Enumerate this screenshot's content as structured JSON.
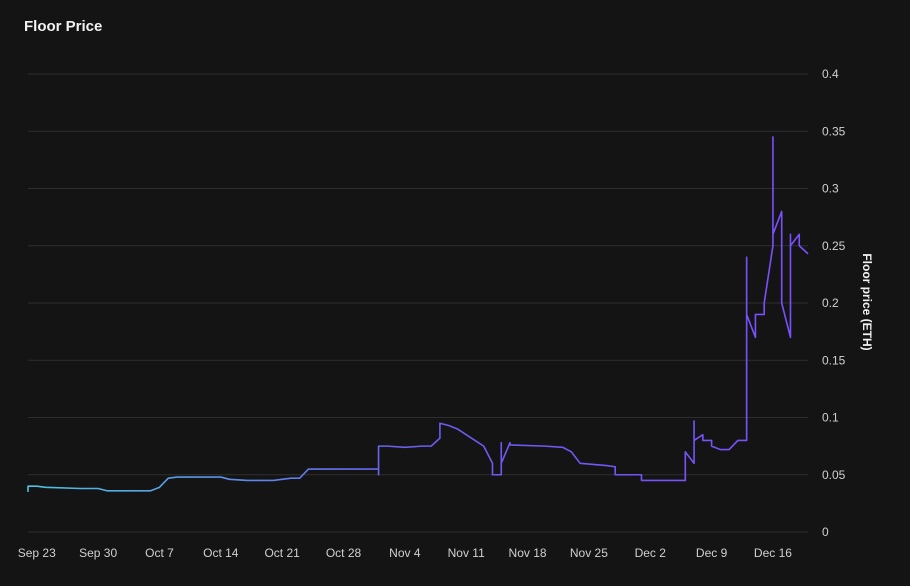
{
  "chart_data": {
    "type": "line",
    "title": "Floor Price",
    "xlabel": "",
    "ylabel": "Floor price (ETH)",
    "x_ticks": [
      "Sep 23",
      "Sep 30",
      "Oct 7",
      "Oct 14",
      "Oct 21",
      "Oct 28",
      "Nov 4",
      "Nov 11",
      "Nov 18",
      "Nov 25",
      "Dec 2",
      "Dec 9",
      "Dec 16"
    ],
    "y_ticks": [
      0,
      0.05,
      0.1,
      0.15,
      0.2,
      0.25,
      0.3,
      0.35,
      0.4
    ],
    "y_tick_labels": [
      "0",
      "0.05",
      "0.1",
      "0.15",
      "0.2",
      "0.25",
      "0.3",
      "0.35",
      "0.4"
    ],
    "ylim": [
      0,
      0.4
    ],
    "xlim": [
      "2023-09-22",
      "2023-12-20"
    ],
    "grid": true,
    "legend": "none",
    "y_axis_position": "right",
    "line_gradient": [
      "#4fc3e0",
      "#6a5cf0",
      "#7b4fff"
    ],
    "series": [
      {
        "x": [
          "2023-09-22",
          "2023-09-22",
          "2023-09-23",
          "2023-09-24",
          "2023-09-28",
          "2023-09-30",
          "2023-10-01",
          "2023-10-06",
          "2023-10-07",
          "2023-10-08",
          "2023-10-09",
          "2023-10-14",
          "2023-10-15",
          "2023-10-17",
          "2023-10-20",
          "2023-10-22",
          "2023-10-23",
          "2023-10-24",
          "2023-10-24",
          "2023-11-01",
          "2023-11-01",
          "2023-11-01",
          "2023-11-02",
          "2023-11-04",
          "2023-11-06",
          "2023-11-07",
          "2023-11-08",
          "2023-11-08",
          "2023-11-09",
          "2023-11-10",
          "2023-11-11",
          "2023-11-12",
          "2023-11-13",
          "2023-11-14",
          "2023-11-14",
          "2023-11-15",
          "2023-11-15",
          "2023-11-15",
          "2023-11-16",
          "2023-11-16",
          "2023-11-16",
          "2023-11-20",
          "2023-11-22",
          "2023-11-23",
          "2023-11-24",
          "2023-11-27",
          "2023-11-28",
          "2023-11-28",
          "2023-12-01",
          "2023-12-01",
          "2023-12-06",
          "2023-12-06",
          "2023-12-07",
          "2023-12-07",
          "2023-12-07",
          "2023-12-08",
          "2023-12-08",
          "2023-12-09",
          "2023-12-09",
          "2023-12-10",
          "2023-12-11",
          "2023-12-12",
          "2023-12-13",
          "2023-12-13",
          "2023-12-13",
          "2023-12-14",
          "2023-12-14",
          "2023-12-14",
          "2023-12-15",
          "2023-12-15",
          "2023-12-16",
          "2023-12-16",
          "2023-12-16",
          "2023-12-16",
          "2023-12-17",
          "2023-12-17",
          "2023-12-17",
          "2023-12-17",
          "2023-12-18",
          "2023-12-18",
          "2023-12-18",
          "2023-12-18",
          "2023-12-19",
          "2023-12-19",
          "2023-12-19",
          "2023-12-19",
          "2023-12-20"
        ],
        "values": [
          0.035,
          0.04,
          0.04,
          0.039,
          0.038,
          0.038,
          0.036,
          0.036,
          0.039,
          0.047,
          0.048,
          0.048,
          0.046,
          0.045,
          0.045,
          0.047,
          0.047,
          0.055,
          0.055,
          0.055,
          0.05,
          0.075,
          0.075,
          0.074,
          0.075,
          0.075,
          0.082,
          0.095,
          0.093,
          0.09,
          0.085,
          0.08,
          0.075,
          0.06,
          0.05,
          0.05,
          0.078,
          0.06,
          0.078,
          0.076,
          0.076,
          0.075,
          0.074,
          0.07,
          0.06,
          0.058,
          0.057,
          0.05,
          0.05,
          0.045,
          0.045,
          0.07,
          0.06,
          0.097,
          0.08,
          0.085,
          0.08,
          0.08,
          0.075,
          0.072,
          0.072,
          0.08,
          0.08,
          0.24,
          0.19,
          0.17,
          0.19,
          0.19,
          0.19,
          0.2,
          0.25,
          0.345,
          0.29,
          0.26,
          0.28,
          0.25,
          0.27,
          0.2,
          0.17,
          0.26,
          0.215,
          0.25,
          0.26,
          0.25,
          0.26,
          0.25,
          0.243
        ]
      }
    ]
  }
}
